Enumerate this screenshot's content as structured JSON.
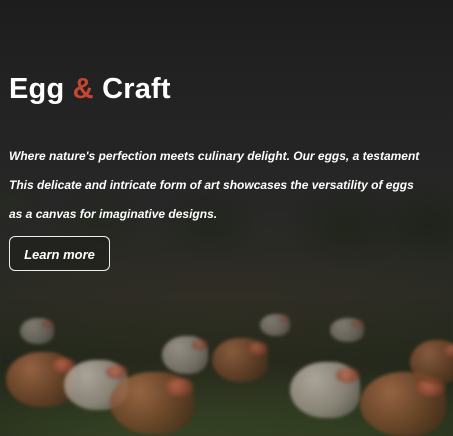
{
  "hero": {
    "title": {
      "part1": "Egg",
      "amp": "&",
      "part2": "Craft"
    },
    "description_lines": [
      "Where nature's perfection meets culinary delight. Our eggs, a testament",
      "This delicate and intricate form of art showcases the versatility of eggs",
      "as a canvas for imaginative designs."
    ],
    "button_label": "Learn more"
  },
  "theme": {
    "accent": "#c4472f",
    "text": "#ffffff"
  }
}
